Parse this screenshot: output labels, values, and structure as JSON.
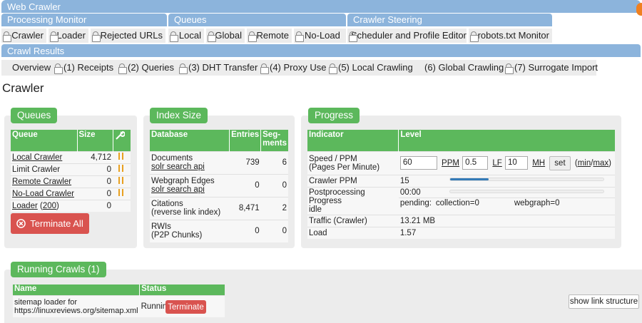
{
  "header": {
    "title": "Web Crawler"
  },
  "sections": {
    "processing_monitor": "Processing Monitor",
    "queues": "Queues",
    "crawler_steering": "Crawler Steering",
    "crawl_results": "Crawl Results"
  },
  "tabs_row1": {
    "crawler": "Crawler",
    "loader": "Loader",
    "rejected": "Rejected URLs",
    "local": "Local",
    "global": "Global",
    "remote": "Remote",
    "noload": "No-Load",
    "scheduler": "Scheduler and Profile Editor",
    "robots": "robots.txt Monitor"
  },
  "tabs_row2": {
    "overview": "Overview",
    "receipts": "(1) Receipts",
    "queries": "(2) Queries",
    "dht": "(3) DHT Transfer",
    "proxy": "(4) Proxy Use",
    "local_crawling": "(5) Local Crawling",
    "global_crawling": "(6) Global Crawling",
    "surrogate": "(7) Surrogate Import"
  },
  "page_title": "Crawler",
  "queues_panel": {
    "title": "Queues",
    "col_queue": "Queue",
    "col_size": "Size",
    "rows": [
      {
        "name": "Local Crawler",
        "size": "4,712",
        "link": true,
        "pause": true
      },
      {
        "name": "Limit Crawler",
        "size": "0",
        "link": false,
        "pause": true
      },
      {
        "name": "Remote Crawler",
        "size": "0",
        "link": true,
        "pause": true
      },
      {
        "name": "No-Load Crawler",
        "size": "0",
        "link": true,
        "pause": true
      }
    ],
    "loader_label": "Loader",
    "loader_count": "200",
    "loader_size": "0",
    "terminate_all": "Terminate All"
  },
  "index_panel": {
    "title": "Index Size",
    "col_db": "Database",
    "col_entries": "Entries",
    "col_segments_1": "Seg-",
    "col_segments_2": "ments",
    "rows": [
      {
        "line1": "Documents",
        "line2": "solr search api",
        "entries": "739",
        "segments": "6",
        "line2_link": true
      },
      {
        "line1": "Webgraph Edges",
        "line2": "solr search api",
        "entries": "0",
        "segments": "0",
        "line2_link": true
      },
      {
        "line1": "Citations",
        "line2": "(reverse link index)",
        "entries": "8,471",
        "segments": "2",
        "line2_link": false
      },
      {
        "line1": "RWIs",
        "line2": "(P2P Chunks)",
        "entries": "0",
        "segments": "0",
        "line2_link": false
      }
    ]
  },
  "progress_panel": {
    "title": "Progress",
    "col_indicator": "Indicator",
    "col_level": "Level",
    "speed_label_1": "Speed / PPM",
    "speed_label_2": "(Pages Per Minute)",
    "ppm_value": "60",
    "ppm_unit": "PPM",
    "lf_value": "0.5",
    "lf_unit": "LF",
    "mh_value": "10",
    "mh_unit": "MH",
    "set_button": "set",
    "min_label": "min",
    "max_label": "max",
    "crawler_ppm_label": "Crawler PPM",
    "crawler_ppm_value": "15",
    "crawler_ppm_fraction": 0.25,
    "postproc_label_1": "Postprocessing Progress",
    "postproc_label_2": "idle",
    "postproc_time": "00:00",
    "postproc_fraction": 0,
    "pending_label": "pending:",
    "collection": "collection=0",
    "webgraph": "webgraph=0",
    "traffic_label": "Traffic (Crawler)",
    "traffic_value": "13.21 MB",
    "load_label": "Load",
    "load_value": "1.57"
  },
  "running_panel": {
    "title": "Running Crawls (1)",
    "col_name": "Name",
    "col_status": "Status",
    "row_name_1": "sitemap loader for",
    "row_name_2": "https://linuxreviews.org/sitemap.xml",
    "row_status": "Running",
    "terminate": "Terminate",
    "show_link_structure": "show link structure"
  }
}
